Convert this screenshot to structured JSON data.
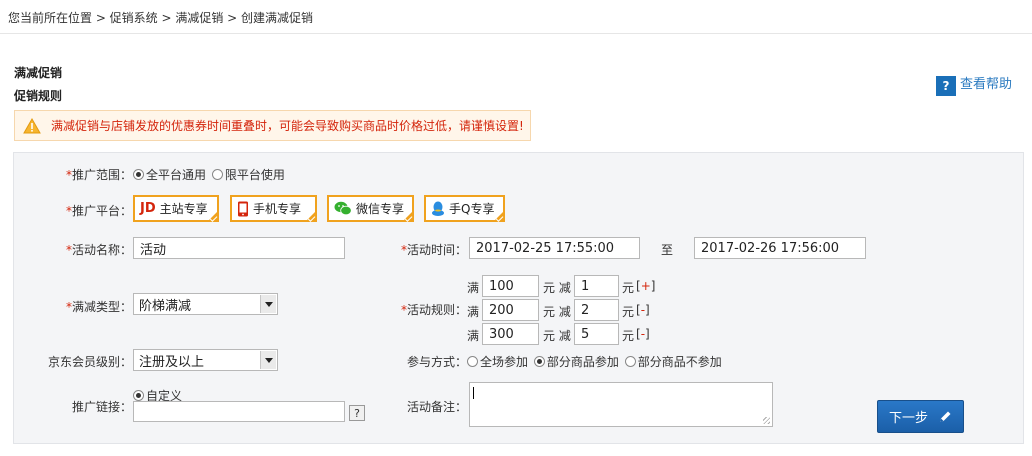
{
  "breadcrumb": "您当前所在位置 > 促销系统 > 满减促销 > 创建满减促销",
  "page": {
    "title": "满减促销",
    "subtitle": "促销规则",
    "help_label": "查看帮助",
    "help_icon_text": "?"
  },
  "warning": {
    "icon": "warning-icon",
    "text": "满减促销与店铺发放的优惠券时间重叠时，可能会导致购买商品时价格过低，请谨慎设置!"
  },
  "form": {
    "scope": {
      "star": "*",
      "label": "推广范围：",
      "options": [
        "全平台通用",
        "限平台使用"
      ],
      "selected": 0
    },
    "platform": {
      "star": "*",
      "label": "推广平台：",
      "items": [
        {
          "icon_text": "JD",
          "label": "主站专享"
        },
        {
          "icon_text": "",
          "label": "手机专享"
        },
        {
          "icon_text": "",
          "label": "微信专享"
        },
        {
          "icon_text": "",
          "label": "手Q专享"
        }
      ]
    },
    "name": {
      "star": "*",
      "label": "活动名称：",
      "value": "活动"
    },
    "time": {
      "star": "*",
      "label": "活动时间：",
      "start": "2017-02-25 17:55:00",
      "to": "至",
      "end": "2017-02-26 17:56:00"
    },
    "type": {
      "star": "*",
      "label": "满减类型：",
      "value": "阶梯满减"
    },
    "rules": {
      "star": "*",
      "label": "活动规则：",
      "man": "满",
      "yuan_jian": "元 减",
      "yuan": "元",
      "rows": [
        {
          "threshold": "100",
          "discount": "1",
          "action": "+"
        },
        {
          "threshold": "200",
          "discount": "2",
          "action": "-"
        },
        {
          "threshold": "300",
          "discount": "5",
          "action": "-"
        }
      ]
    },
    "member": {
      "label": "京东会员级别：",
      "value": "注册及以上"
    },
    "participate": {
      "label": "参与方式：",
      "options": [
        "全场参加",
        "部分商品参加",
        "部分商品不参加"
      ],
      "selected": 1
    },
    "link": {
      "label": "推广链接：",
      "option": "自定义",
      "value": "",
      "help": "?"
    },
    "remark": {
      "label": "活动备注：",
      "value": ""
    },
    "next_label": "下一步"
  },
  "colors": {
    "accent": "#1b5fa8",
    "warn_text": "#d4250c",
    "platform_border": "#f0a21e"
  }
}
